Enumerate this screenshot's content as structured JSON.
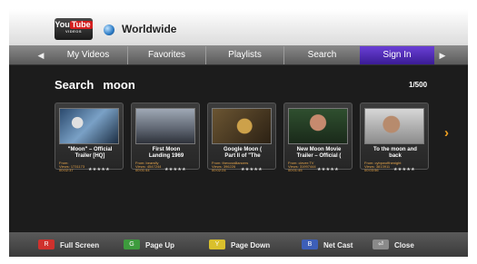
{
  "header": {
    "logo": {
      "you": "You",
      "tube": "Tube",
      "sub": "VIDEOS"
    },
    "region": "Worldwide"
  },
  "tabs": [
    "My Videos",
    "Favorites",
    "Playlists",
    "Search",
    "Sign In"
  ],
  "active_tab": "Sign In",
  "search": {
    "label": "Search",
    "term": "moon",
    "counter": "1/500"
  },
  "results": [
    {
      "title": "\"Moon\" – Official\nTrailer [HQ]",
      "from": "From:",
      "views": "Views: 1731173",
      "duration": "00:02:37",
      "stars": "★★★★★"
    },
    {
      "title": "First Moon\nLanding 1969",
      "from": "From: bearsfly",
      "views": "Views: 4547244",
      "duration": "00:01:44",
      "stars": "★★★★★"
    },
    {
      "title": "Google Moon (\nPart II of \"The",
      "from": "From: thevoxalliancers",
      "views": "Views: 396226",
      "duration": "00:02:24",
      "stars": "★★★★★"
    },
    {
      "title": "New Moon Movie\nTrailer – Official (",
      "from": "From: clever:TV",
      "views": "Views: 31997444",
      "duration": "00:01:45",
      "stars": "★★★★★"
    },
    {
      "title": "To the moon and\nback",
      "from": "From: cybpwofthenight",
      "views": "Views: 3813911",
      "duration": "00:03:56",
      "stars": "★★★★★"
    }
  ],
  "footer": [
    {
      "key": "R",
      "label": "Full Screen",
      "color": "#d0312d"
    },
    {
      "key": "G",
      "label": "Page Up",
      "color": "#3d9b3d"
    },
    {
      "key": "Y",
      "label": "Page Down",
      "color": "#d9c02c"
    },
    {
      "key": "B",
      "label": "Net Cast",
      "color": "#3d5fb8"
    },
    {
      "key": "⏎",
      "label": "Close",
      "color": "#8a8a8a"
    }
  ],
  "colors": {
    "accent_tab": "#4a2ab0",
    "meta_text": "#e7a64c",
    "next_arrow": "#f0a020"
  }
}
